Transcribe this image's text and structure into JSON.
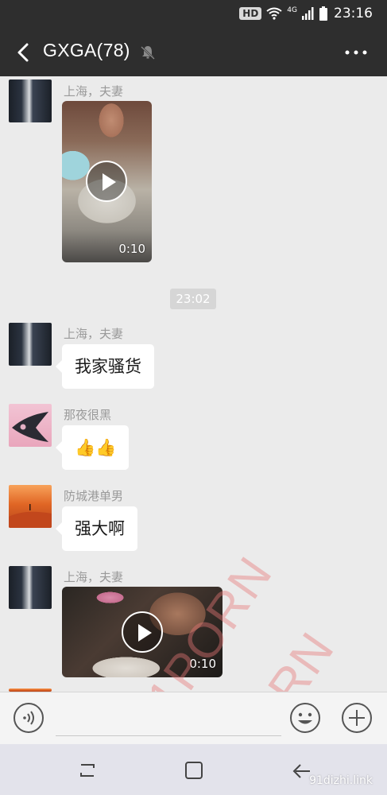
{
  "status_bar": {
    "hd_badge": "HD",
    "network": "4G",
    "time": "23:16"
  },
  "header": {
    "title": "GXGA(78)"
  },
  "messages": [
    {
      "sender": "上海，夫妻",
      "type": "video",
      "duration": "0:10"
    },
    {
      "type": "timestamp",
      "text": "23:02"
    },
    {
      "sender": "上海，夫妻",
      "type": "text",
      "text": "我家骚货"
    },
    {
      "sender": "那夜很黑",
      "type": "text",
      "text": "👍👍"
    },
    {
      "sender": "防城港单男",
      "type": "text",
      "text": "强大啊"
    },
    {
      "sender": "上海，夫妻",
      "type": "video",
      "duration": "0:10"
    }
  ],
  "watermark": {
    "text": "91PORN"
  },
  "input_bar": {
    "placeholder": ""
  },
  "nav": {
    "site_mark": "91dizhi.link"
  },
  "colors": {
    "header_bg": "#2e2e2e",
    "chat_bg": "#ebebeb",
    "bubble_bg": "#ffffff",
    "sender_text": "#9a9a9a",
    "watermark": "#e67878"
  }
}
